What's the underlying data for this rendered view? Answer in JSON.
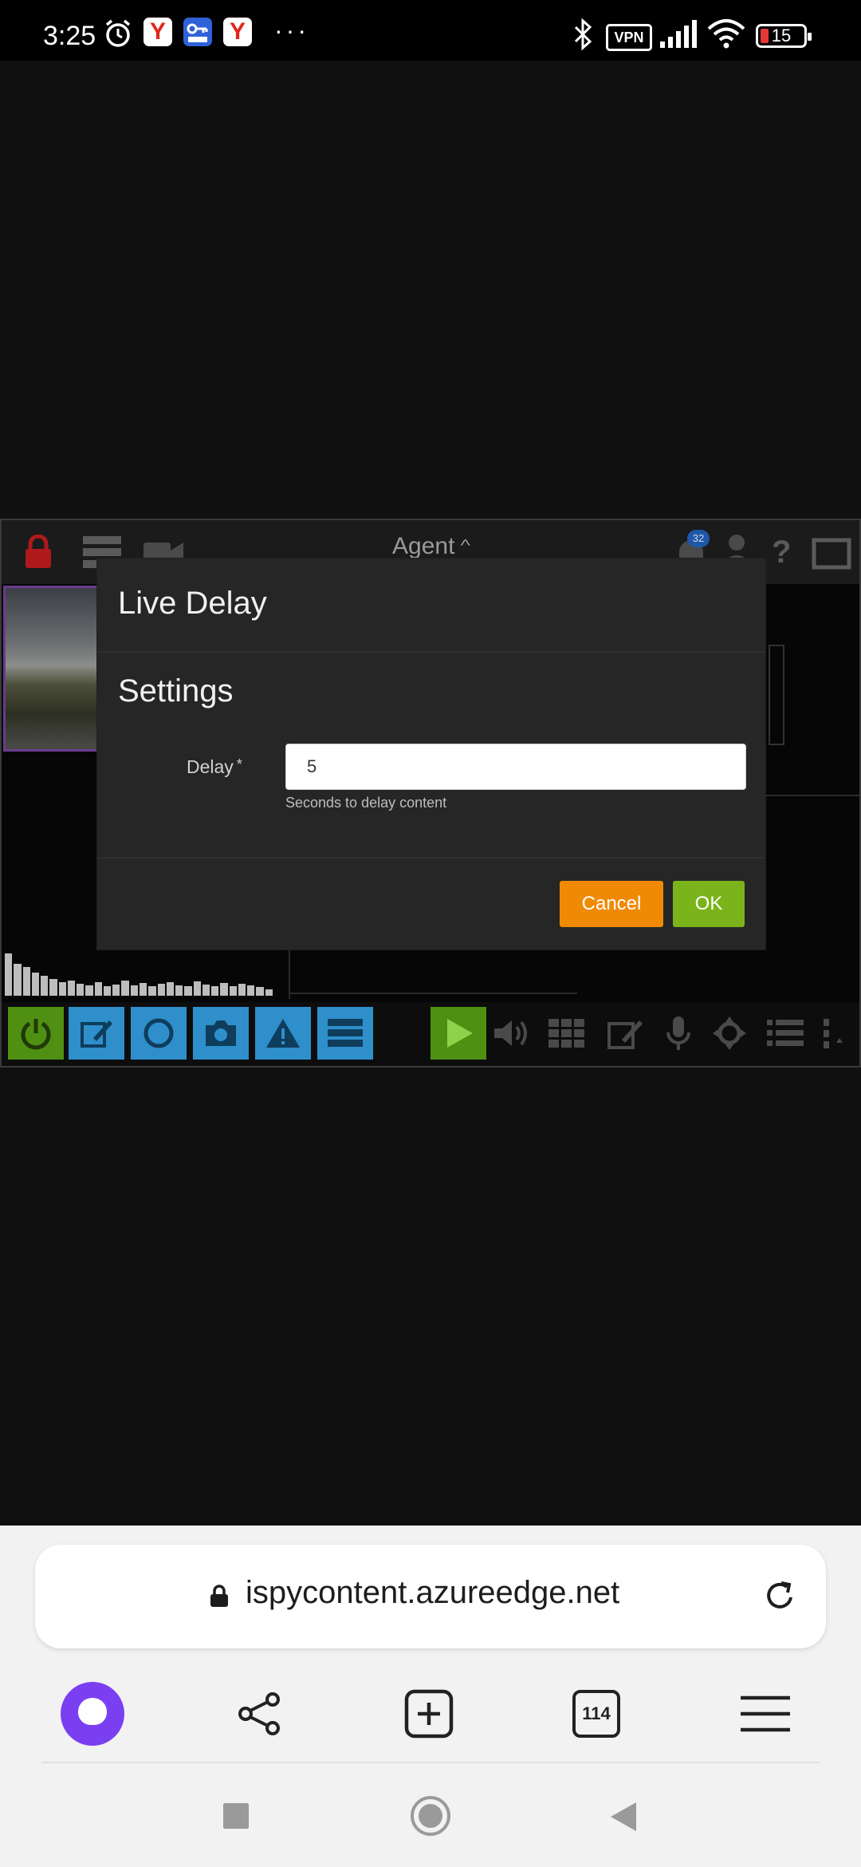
{
  "status_bar": {
    "time": "3:25",
    "vpn_label": "VPN",
    "battery": "15",
    "more": "···"
  },
  "app": {
    "title": "Agent",
    "title_caret": "^",
    "notification_count": "32"
  },
  "dialog": {
    "title": "Live Delay",
    "section": "Settings",
    "field_label": "Delay",
    "required_mark": "*",
    "field_value": "5",
    "help_text": "Seconds to delay content",
    "cancel_label": "Cancel",
    "ok_label": "OK"
  },
  "browser": {
    "url": "ispycontent.azureedge.net",
    "tabs_count": "114"
  },
  "colors": {
    "accent_purple": "#7b3ff2",
    "cancel_orange": "#f08a05",
    "ok_green": "#7bb41a",
    "toolbar_blue": "#2e8fcb",
    "toolbar_green": "#4f8f12"
  }
}
